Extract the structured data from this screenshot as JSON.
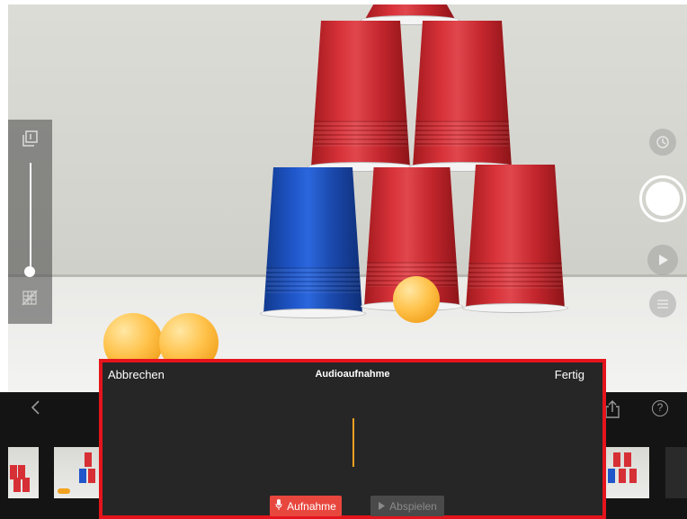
{
  "dialog": {
    "title": "Audioaufnahme",
    "cancel_label": "Abbrechen",
    "done_label": "Fertig",
    "record_label": "Aufnahme",
    "play_label": "Abspielen",
    "accent_color": "#e4141c",
    "playhead_color": "#f0a020"
  },
  "icons": {
    "zoom_top": "camera-switch-icon",
    "zoom_bottom": "grid-off-icon",
    "timer": "timer-icon",
    "shutter": "shutter-button",
    "play": "play-icon",
    "menu": "list-icon",
    "back": "chevron-left-icon",
    "share": "share-icon",
    "help": "help-icon",
    "microphone": "microphone-icon"
  },
  "toolbar": {
    "help_glyph": "?"
  }
}
